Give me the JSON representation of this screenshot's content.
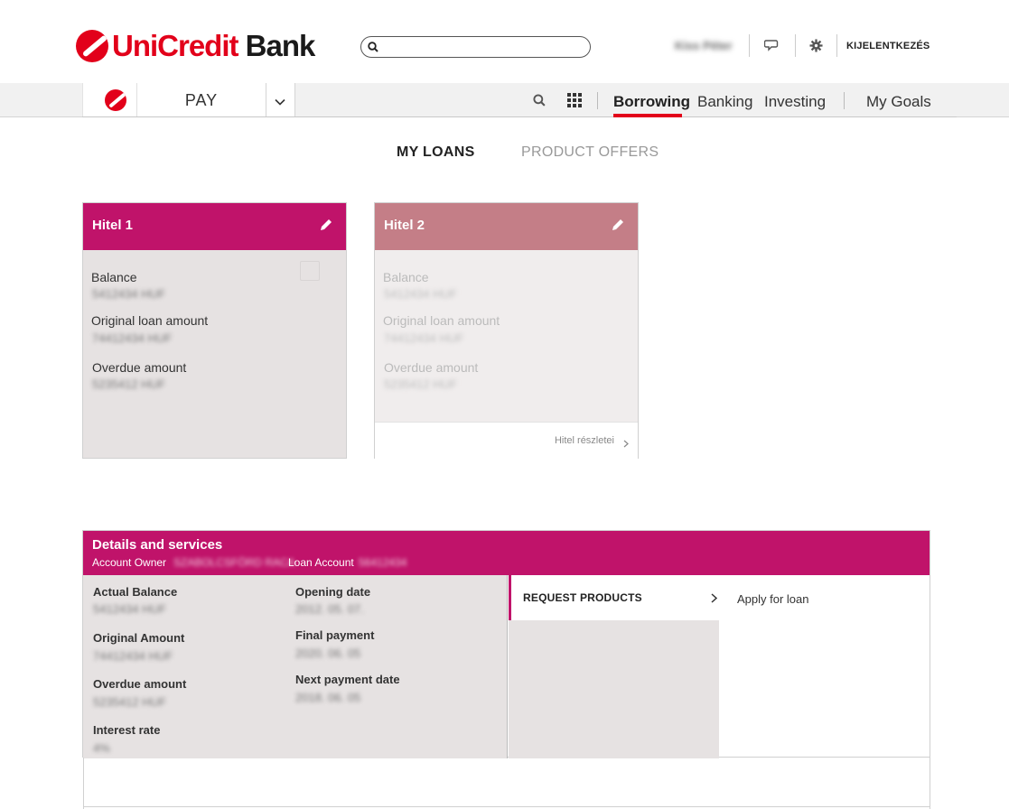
{
  "brand": {
    "name": "UniCredit",
    "suffix": " Bank",
    "colors": {
      "primary": "#e2001a",
      "magenta": "#c0136a",
      "muted_pink": "#c47e87"
    }
  },
  "header": {
    "search": {
      "value": "",
      "placeholder": ""
    },
    "user_name": "Kiss Péter",
    "logout_label": "KIJELENTKEZÉS",
    "icons": [
      "search-icon",
      "chat-icon",
      "gear-icon"
    ]
  },
  "nav": {
    "app_label": "PAY",
    "items": [
      {
        "label": "Borrowing",
        "active": true
      },
      {
        "label": "Banking",
        "active": false
      },
      {
        "label": "Investing",
        "active": false
      },
      {
        "label": "My Goals",
        "active": false
      }
    ]
  },
  "tabs": [
    {
      "label": "MY LOANS",
      "active": true
    },
    {
      "label": "PRODUCT OFFERS",
      "active": false
    }
  ],
  "loans": [
    {
      "title": "Hitel 1",
      "balance_label": "Balance",
      "balance_value": "5412434 HUF",
      "original_label": "Original loan amount",
      "original_value": "74412434 HUF",
      "overdue_label": "Overdue amount",
      "overdue_value": "5235412 HUF"
    },
    {
      "title": "Hitel 2",
      "balance_label": "Balance",
      "balance_value": "5412434 HUF",
      "original_label": "Original loan amount",
      "original_value": "74412434 HUF",
      "overdue_label": "Overdue amount",
      "overdue_value": "5235412 HUF",
      "details_link": "Hitel részletei"
    }
  ],
  "details": {
    "title": "Details and services",
    "account_owner_label": "Account Owner",
    "account_owner_value": "SZABOLCSFÖRD RACA",
    "loan_account_label": "Loan Account",
    "loan_account_value": "56412434",
    "actual_balance_label": "Actual Balance",
    "actual_balance_value": "5412434 HUF",
    "original_amount_label": "Original Amount",
    "original_amount_value": "74412434 HUF",
    "overdue_amount_label": "Overdue amount",
    "overdue_amount_value": "5235412 HUF",
    "interest_rate_label": "Interest rate",
    "interest_rate_value": "4%",
    "opening_date_label": "Opening date",
    "opening_date_value": "2012. 05. 07.",
    "final_payment_label": "Final payment",
    "final_payment_value": "2020. 06. 05",
    "next_payment_label": "Next payment date",
    "next_payment_value": "2018. 06. 05",
    "request_products_label": "REQUEST PRODUCTS",
    "apply_loan_label": "Apply for loan"
  }
}
